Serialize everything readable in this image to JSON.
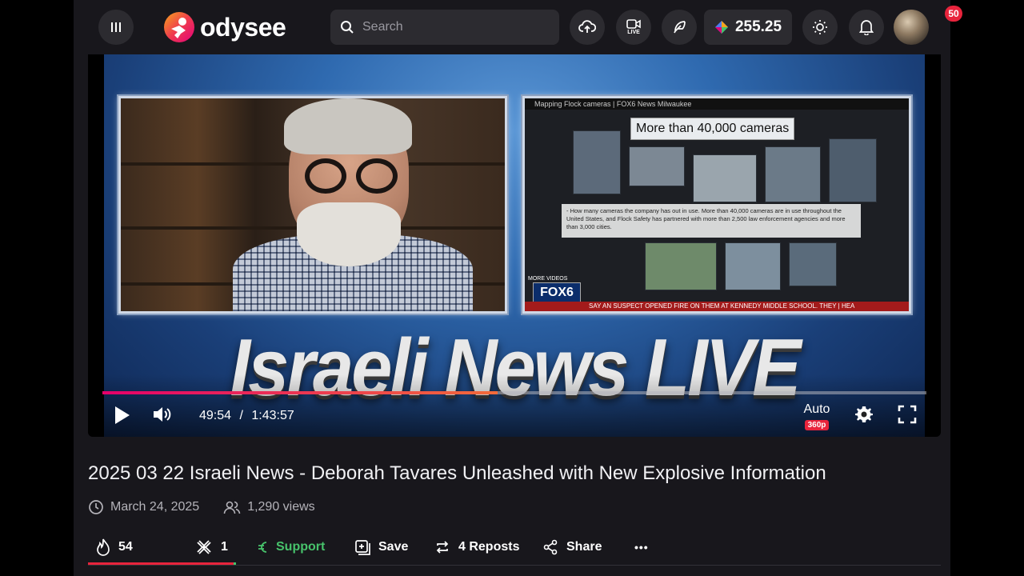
{
  "header": {
    "brand": "odysee",
    "search_placeholder": "Search",
    "live_label": "LIVE",
    "wallet_balance": "255.25",
    "notifications_count": "50"
  },
  "player": {
    "overlay": {
      "news_bar": "Mapping Flock cameras | FOX6 News Milwaukee",
      "headline": "More than 40,000 cameras",
      "body": "- How many cameras the company has out in use. More than 40,000 cameras are in use throughout the United States, and Flock Safety has partnered with more than 2,500 law enforcement agencies and more than 3,000 cities.",
      "more_videos": "MORE VIDEOS",
      "network": "FOX6",
      "ticker": "SAY AN SUSPECT OPENED FIRE ON THEM AT KENNEDY MIDDLE SCHOOL. THEY | HEA",
      "show_title": "Israeli News LIVE"
    },
    "current_time": "49:54",
    "time_separator": "/",
    "duration": "1:43:57",
    "progress": 0.48,
    "quality_mode": "Auto",
    "quality_res": "360p"
  },
  "video": {
    "title": "2025 03 22 Israeli News - Deborah Tavares Unleashed with New Explosive Information",
    "date": "March 24, 2025",
    "views": "1,290 views"
  },
  "actions": {
    "fire_count": "54",
    "slime_count": "1",
    "support_label": "Support",
    "save_label": "Save",
    "reposts_label": "4 Reposts",
    "share_label": "Share",
    "more_label": "•••",
    "like_ratio": 0.98
  },
  "colors": {
    "accent": "#e5006a",
    "badge": "#e8243c",
    "support": "#47c26b",
    "surface": "#18171c",
    "button": "#2c2b30"
  },
  "icons": {
    "menu": "menu-icon",
    "search": "search-icon",
    "upload": "cloud-upload-icon",
    "live": "video-camera-icon",
    "publish": "feather-icon",
    "theme": "sun-icon",
    "notifications": "bell-icon",
    "play": "play-icon",
    "volume": "volume-icon",
    "settings": "gear-icon",
    "fullscreen": "fullscreen-icon"
  }
}
